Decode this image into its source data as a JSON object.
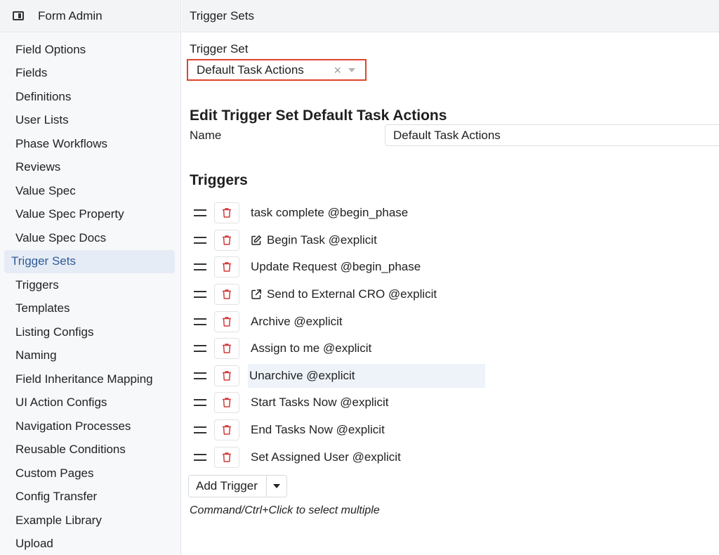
{
  "sidebar": {
    "header_icon": "panel-layout-icon",
    "title": "Form Admin",
    "items": [
      {
        "label": "Field Options"
      },
      {
        "label": "Fields"
      },
      {
        "label": "Definitions"
      },
      {
        "label": "User Lists"
      },
      {
        "label": "Phase Workflows"
      },
      {
        "label": "Reviews"
      },
      {
        "label": "Value Spec"
      },
      {
        "label": "Value Spec Property"
      },
      {
        "label": "Value Spec Docs"
      },
      {
        "label": "Trigger Sets",
        "active": true
      },
      {
        "label": "Triggers"
      },
      {
        "label": "Templates"
      },
      {
        "label": "Listing Configs"
      },
      {
        "label": "Naming"
      },
      {
        "label": "Field Inheritance Mapping"
      },
      {
        "label": "UI Action Configs"
      },
      {
        "label": "Navigation Processes"
      },
      {
        "label": "Reusable Conditions"
      },
      {
        "label": "Custom Pages"
      },
      {
        "label": "Config Transfer"
      },
      {
        "label": "Example Library"
      },
      {
        "label": "Upload"
      }
    ]
  },
  "header": {
    "title": "Trigger Sets"
  },
  "trigger_set": {
    "label": "Trigger Set",
    "selected": "Default Task Actions",
    "clear_glyph": "×",
    "highlight_color": "#e0442c"
  },
  "edit": {
    "heading": "Edit Trigger Set Default Task Actions",
    "name_label": "Name",
    "name_value": "Default Task Actions"
  },
  "triggers": {
    "heading": "Triggers",
    "items": [
      {
        "label": "task complete @begin_phase",
        "icon": null
      },
      {
        "label": "Begin Task @explicit",
        "icon": "edit-icon"
      },
      {
        "label": "Update Request @begin_phase",
        "icon": null
      },
      {
        "label": "Send to External CRO @explicit",
        "icon": "external-link-icon"
      },
      {
        "label": "Archive @explicit",
        "icon": null
      },
      {
        "label": "Assign to me @explicit",
        "icon": null
      },
      {
        "label": "Unarchive @explicit",
        "icon": null,
        "highlight": true
      },
      {
        "label": "Start Tasks Now @explicit",
        "icon": null
      },
      {
        "label": "End Tasks Now @explicit",
        "icon": null
      },
      {
        "label": "Set Assigned User @explicit",
        "icon": null
      }
    ],
    "row_icons": {
      "drag": "drag-handle-icon",
      "delete": "trash-icon"
    },
    "delete_color": "#d23a3a"
  },
  "actions": {
    "add_trigger_label": "Add Trigger",
    "hint": "Command/Ctrl+Click to select multiple"
  }
}
